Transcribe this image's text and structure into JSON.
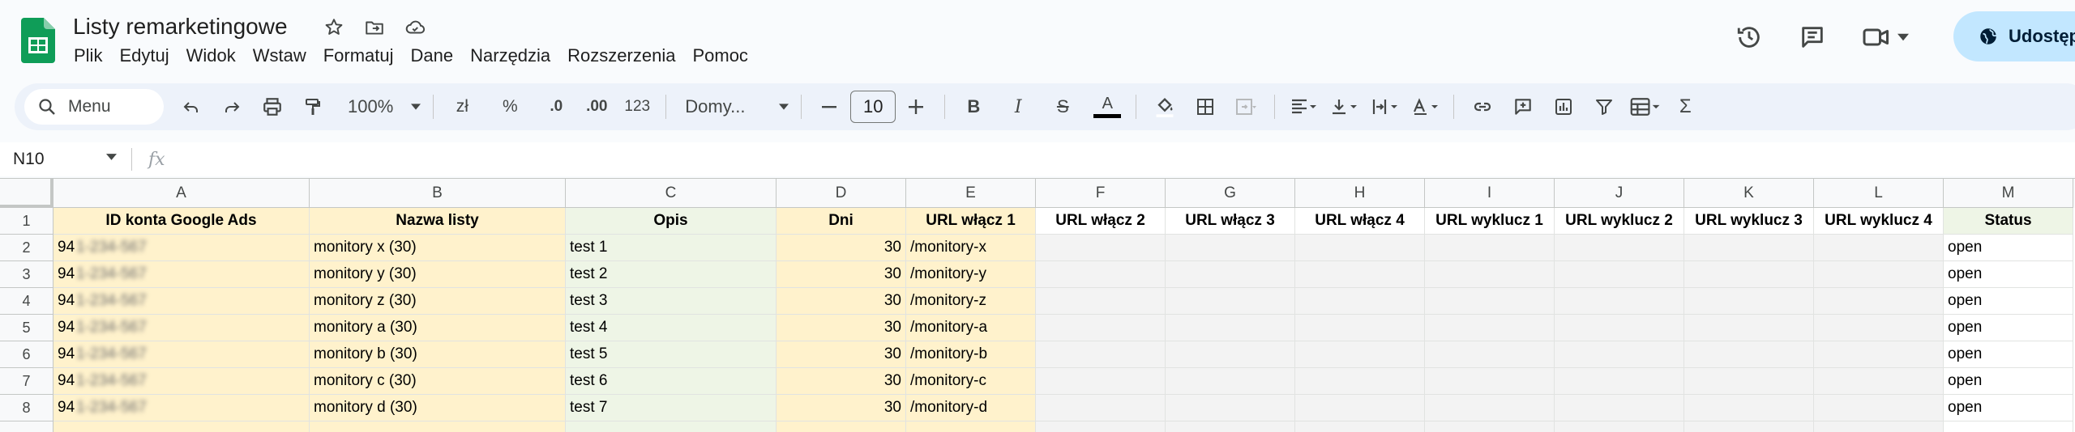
{
  "app": {
    "title": "Listy remarketingowe",
    "share_label": "Udostępnij"
  },
  "menu": [
    "Plik",
    "Edytuj",
    "Widok",
    "Wstaw",
    "Formatuj",
    "Dane",
    "Narzędzia",
    "Rozszerzenia",
    "Pomoc"
  ],
  "toolbar": {
    "search_label": "Menu",
    "zoom": "100%",
    "currency": "zł",
    "percent": "%",
    "dec_decrease": ".0",
    "dec_increase": ".00",
    "number_format": "123",
    "font_name": "Domy...",
    "font_size": "10"
  },
  "formula_bar": {
    "cell_ref": "N10",
    "fx": "fx",
    "content": ""
  },
  "grid": {
    "columns": [
      "A",
      "B",
      "C",
      "D",
      "E",
      "F",
      "G",
      "H",
      "I",
      "J",
      "K",
      "L",
      "M"
    ],
    "row_numbers": [
      "1",
      "2",
      "3",
      "4",
      "5",
      "6",
      "7",
      "8"
    ],
    "header_row": [
      "ID konta Google Ads",
      "Nazwa listy",
      "Opis",
      "Dni",
      "URL włącz 1",
      "URL włącz 2",
      "URL włącz 3",
      "URL włącz 4",
      "URL wyklucz 1",
      "URL wyklucz 2",
      "URL wyklucz 3",
      "URL wyklucz 4",
      "Status"
    ],
    "rows": [
      {
        "id_prefix": "94",
        "id_hidden": "1-234-567",
        "name": "monitory x (30)",
        "desc": "test 1",
        "days": "30",
        "url1": "/monitory-x",
        "status": "open"
      },
      {
        "id_prefix": "94",
        "id_hidden": "1-234-567",
        "name": "monitory y (30)",
        "desc": "test 2",
        "days": "30",
        "url1": "/monitory-y",
        "status": "open"
      },
      {
        "id_prefix": "94",
        "id_hidden": "1-234-567",
        "name": "monitory z (30)",
        "desc": "test 3",
        "days": "30",
        "url1": "/monitory-z",
        "status": "open"
      },
      {
        "id_prefix": "94",
        "id_hidden": "1-234-567",
        "name": "monitory a (30)",
        "desc": "test 4",
        "days": "30",
        "url1": "/monitory-a",
        "status": "open"
      },
      {
        "id_prefix": "94",
        "id_hidden": "1-234-567",
        "name": "monitory b (30)",
        "desc": "test 5",
        "days": "30",
        "url1": "/monitory-b",
        "status": "open"
      },
      {
        "id_prefix": "94",
        "id_hidden": "1-234-567",
        "name": "monitory c (30)",
        "desc": "test 6",
        "days": "30",
        "url1": "/monitory-c",
        "status": "open"
      },
      {
        "id_prefix": "94",
        "id_hidden": "1-234-567",
        "name": "monitory d (30)",
        "desc": "test 7",
        "days": "30",
        "url1": "/monitory-d",
        "status": "open"
      }
    ]
  },
  "colors": {
    "yellow_fill": "#fff2cc",
    "green_fill": "#eef5e6",
    "grey_fill": "#f3f3f3",
    "share_bg": "#c2e7ff",
    "sheets_green": "#0f9d58"
  }
}
